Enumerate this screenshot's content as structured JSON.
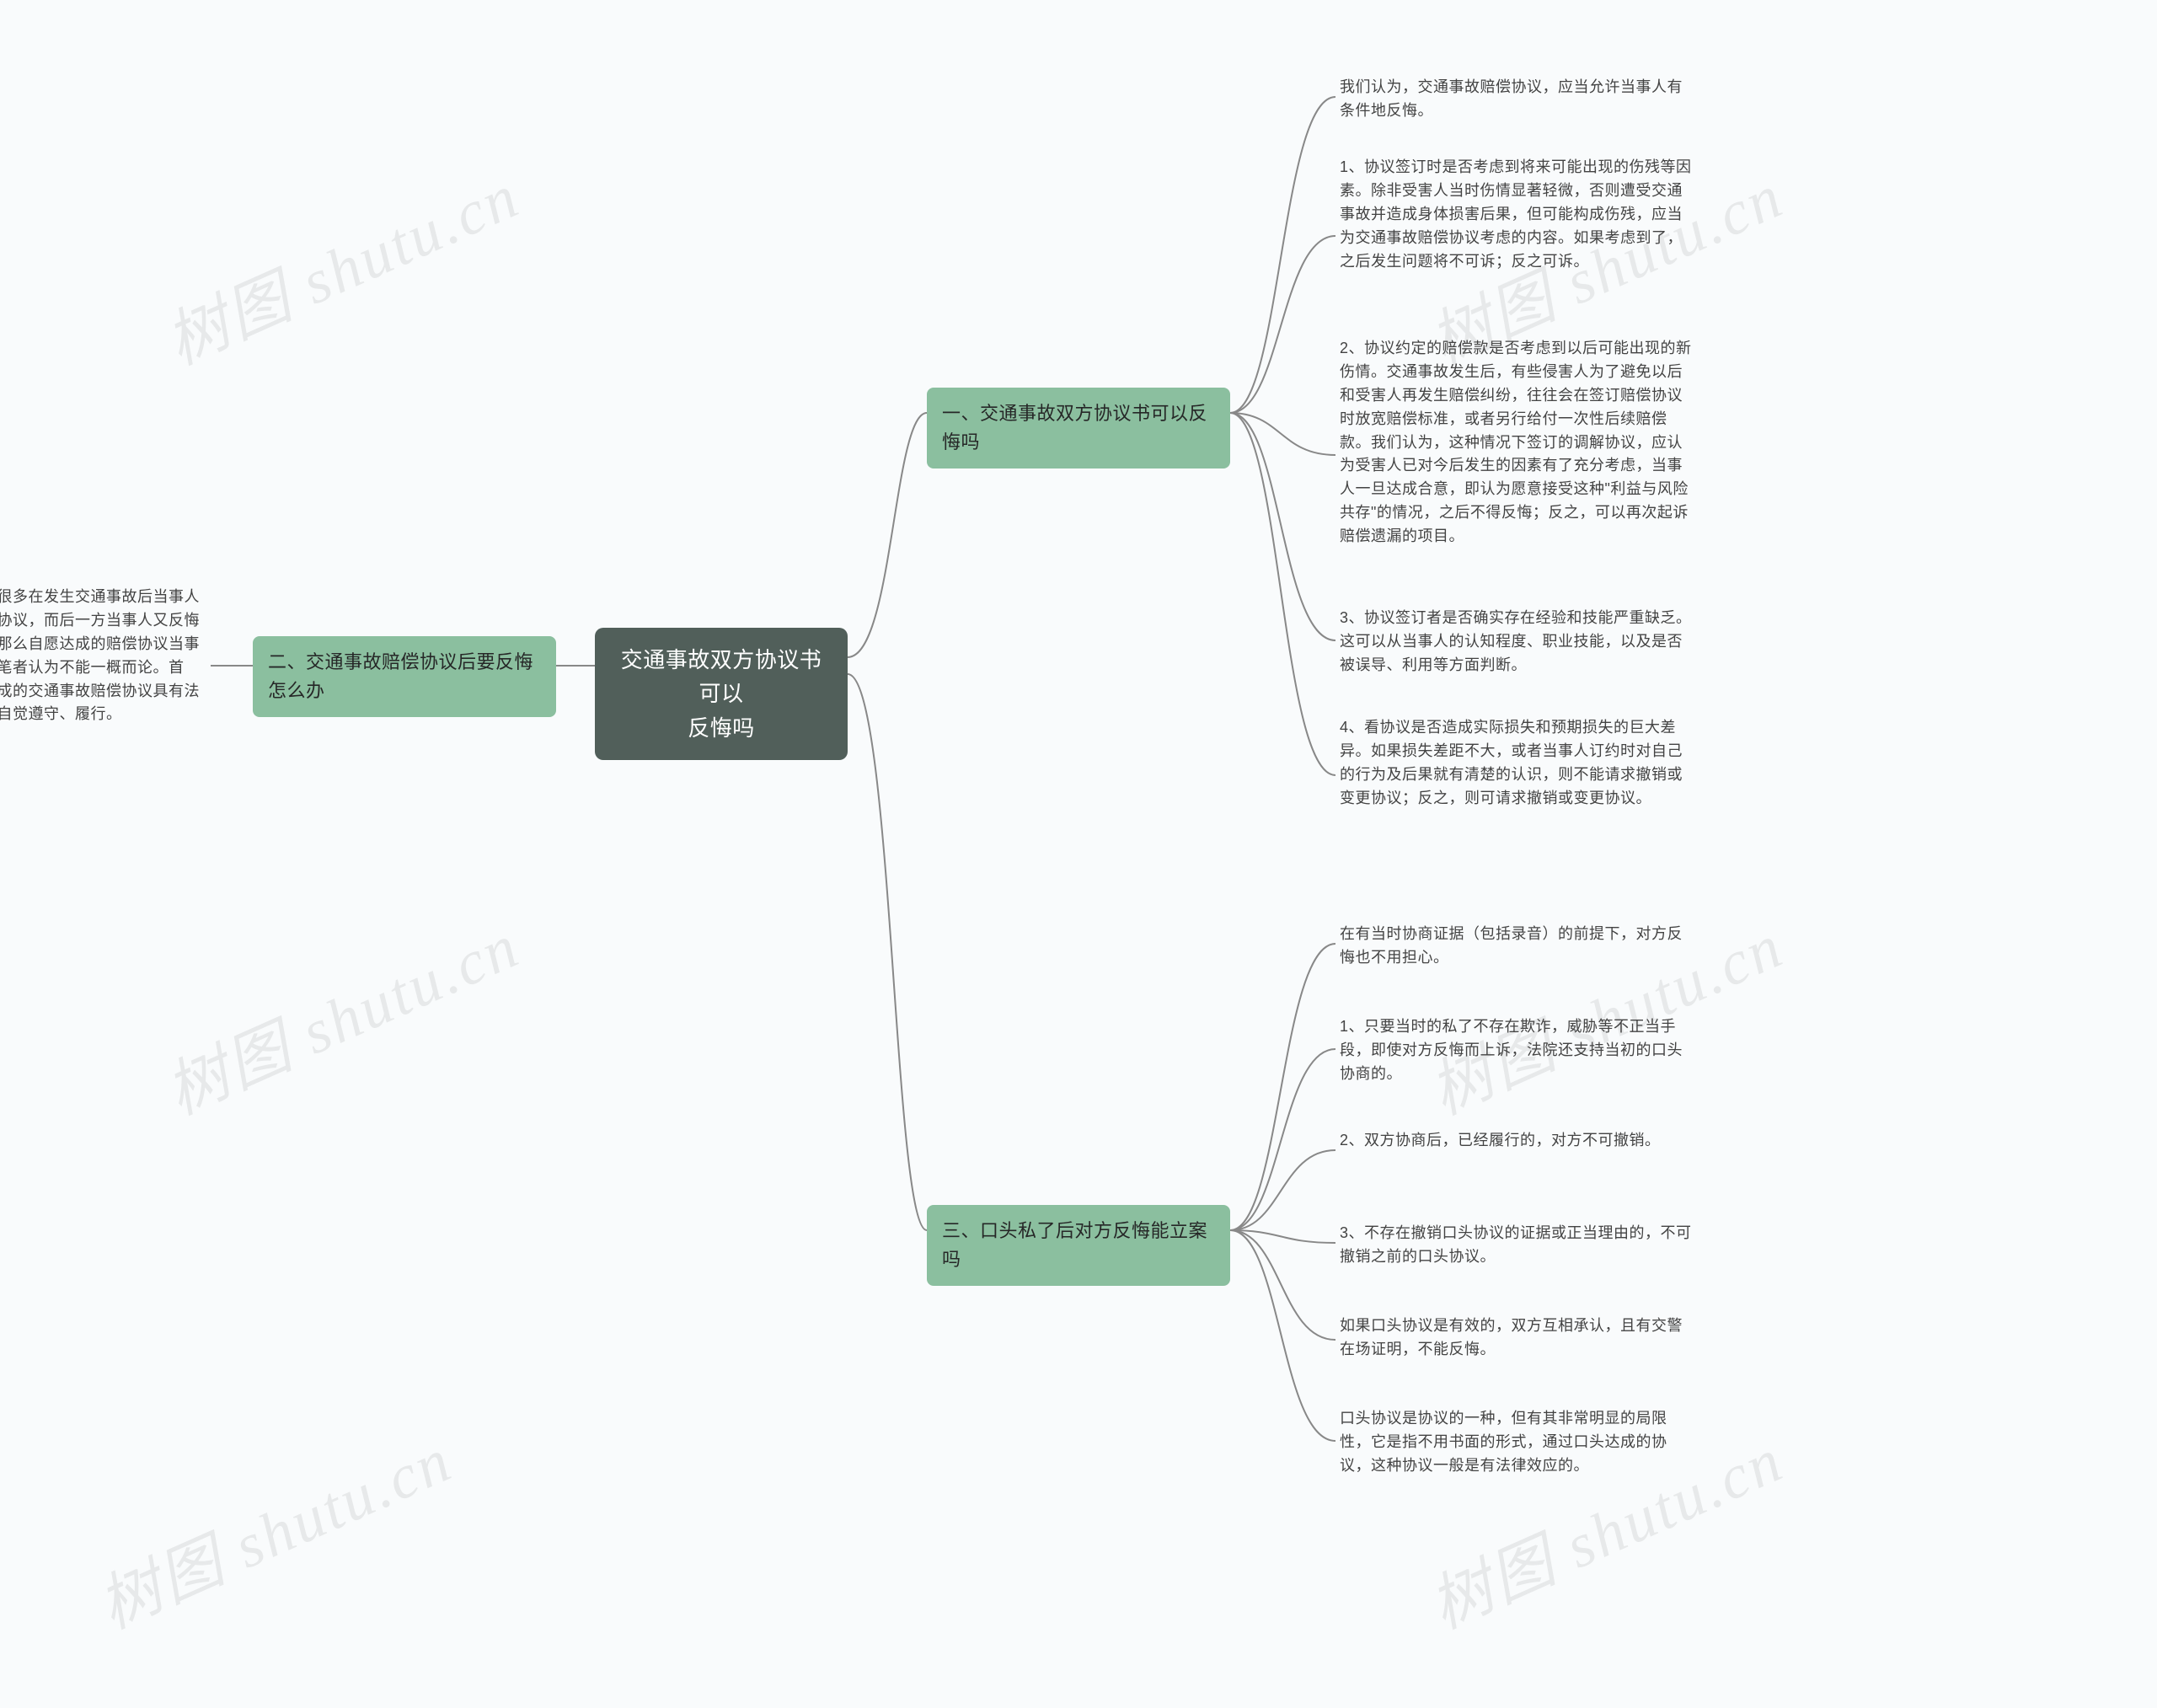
{
  "watermark": "树图 shutu.cn",
  "root": {
    "title": "交通事故双方协议书可以\n反悔吗"
  },
  "branches": {
    "b1": {
      "label": "一、交通事故双方协议书可以反悔吗",
      "leaves": [
        "我们认为，交通事故赔偿协议，应当允许当事人有条件地反悔。",
        "1、协议签订时是否考虑到将来可能出现的伤残等因素。除非受害人当时伤情显著轻微，否则遭受交通事故并造成身体损害后果，但可能构成伤残，应当为交通事故赔偿协议考虑的内容。如果考虑到了，之后发生问题将不可诉；反之可诉。",
        "2、协议约定的赔偿款是否考虑到以后可能出现的新伤情。交通事故发生后，有些侵害人为了避免以后和受害人再发生赔偿纠纷，往往会在签订赔偿协议时放宽赔偿标准，或者另行给付一次性后续赔偿款。我们认为，这种情况下签订的调解协议，应认为受害人已对今后发生的因素有了充分考虑，当事人一旦达成合意，即认为愿意接受这种\"利益与风险共存\"的情况，之后不得反悔；反之，可以再次起诉赔偿遗漏的项目。",
        "3、协议签订者是否确实存在经验和技能严重缺乏。这可以从当事人的认知程度、职业技能，以及是否被误导、利用等方面判断。",
        "4、看协议是否造成实际损失和预期损失的巨大差异。如果损失差距不大，或者当事人订约时对自己的行为及后果就有清楚的认识，则不能请求撤销或变更协议；反之，则可请求撤销或变更协议。"
      ]
    },
    "b2": {
      "label": "二、交通事故赔偿协议后要反悔怎么办",
      "leaves": [
        "在司法实践中，存在很多在发生交通事故后当事人双方达成并签订赔偿协议，而后一方当事人又反悔起诉到法院的案件。那么自愿达成的赔偿协议当事人到底能否反悔呢？笔者认为不能一概而论。首先，一般来讲自愿达成的交通事故赔偿协议具有法律约束力，各方应当自觉遵守、履行。"
      ]
    },
    "b3": {
      "label": "三、口头私了后对方反悔能立案吗",
      "leaves": [
        "在有当时协商证据（包括录音）的前提下，对方反悔也不用担心。",
        "1、只要当时的私了不存在欺诈，威胁等不正当手段，即使对方反悔而上诉，法院还支持当初的口头协商的。",
        "2、双方协商后，已经履行的，对方不可撤销。",
        "3、不存在撤销口头协议的证据或正当理由的，不可撤销之前的口头协议。",
        "如果口头协议是有效的，双方互相承认，且有交警在场证明，不能反悔。",
        "口头协议是协议的一种，但有其非常明显的局限性，它是指不用书面的形式，通过口头达成的协议，这种协议一般是有法律效应的。"
      ]
    }
  }
}
